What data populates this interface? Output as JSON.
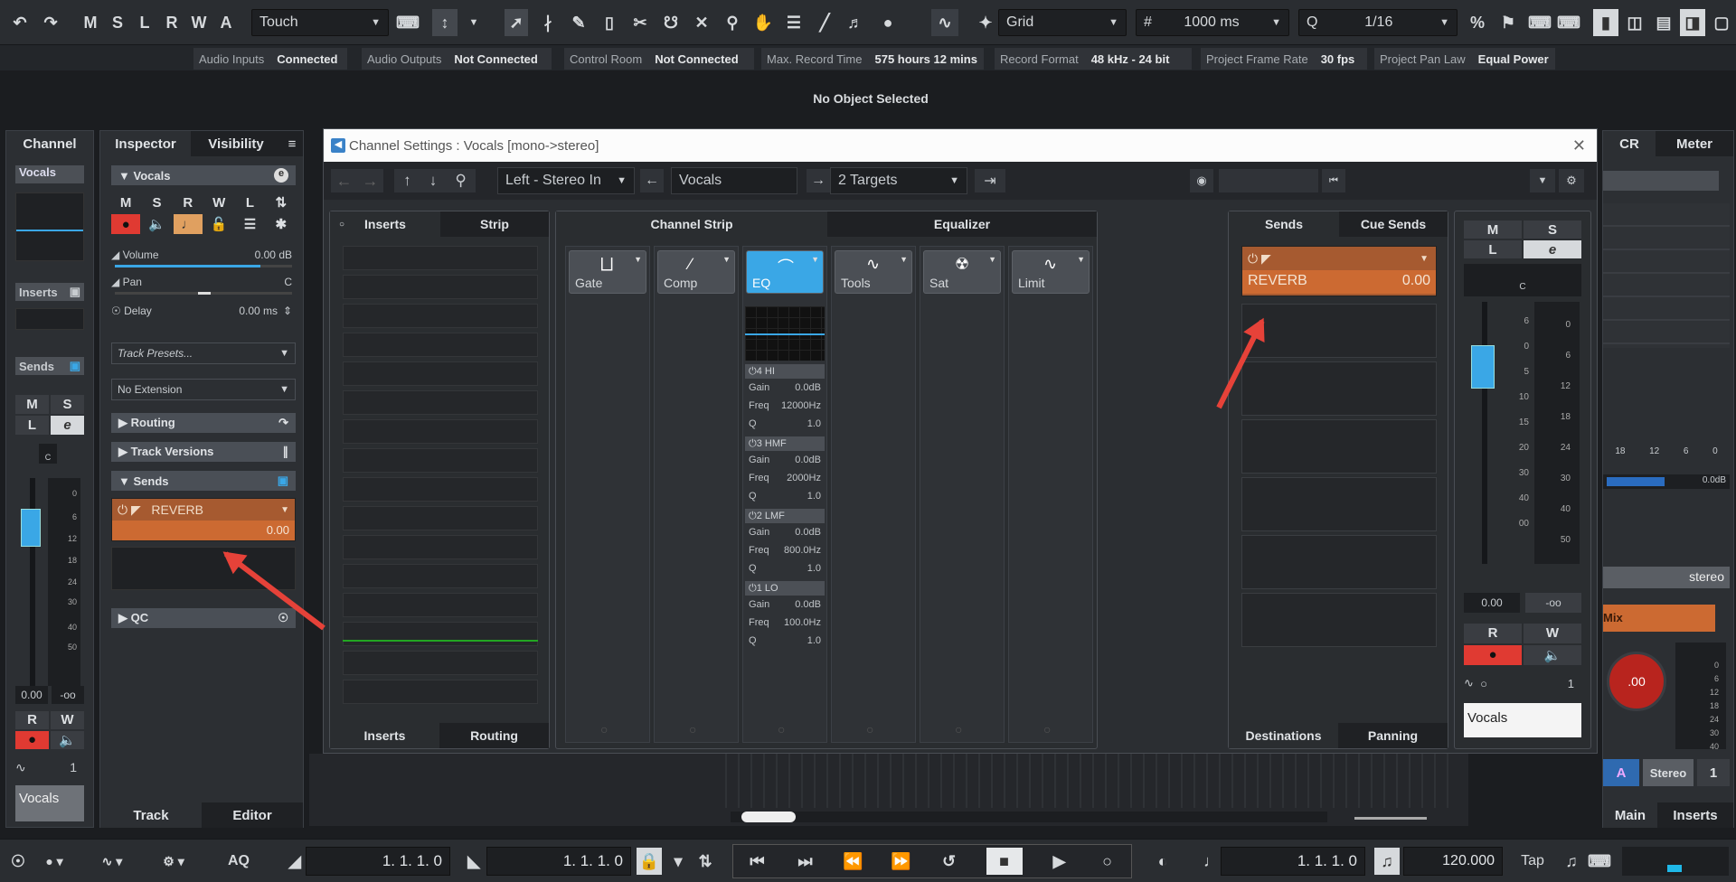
{
  "toolbar": {
    "mode_buttons": [
      "M",
      "S",
      "L",
      "R",
      "W",
      "A"
    ],
    "automation_mode": "Touch",
    "snap_type": "Grid",
    "grid_value": "1000 ms",
    "quantize_value": "1/16"
  },
  "status_bar": [
    {
      "label": "Audio Inputs",
      "value": "Connected"
    },
    {
      "label": "Audio Outputs",
      "value": "Not Connected"
    },
    {
      "label": "Control Room",
      "value": "Not Connected"
    },
    {
      "label": "Max. Record Time",
      "value": "575 hours 12 mins"
    },
    {
      "label": "Record Format",
      "value": "48 kHz - 24 bit"
    },
    {
      "label": "Project Frame Rate",
      "value": "30 fps"
    },
    {
      "label": "Project Pan Law",
      "value": "Equal Power"
    }
  ],
  "info_line": "No Object Selected",
  "channel_panel": {
    "tab": "Channel",
    "track_name": "Vocals",
    "inserts_label": "Inserts",
    "sends_label": "Sends",
    "m": "M",
    "s": "S",
    "l": "L",
    "e": "e",
    "r": "R",
    "w": "W",
    "fader_scale": [
      "0",
      "6",
      "12",
      "18",
      "24",
      "30",
      "40",
      "50"
    ],
    "value_left": "0.00",
    "value_right": "-oo",
    "channel_num": "1",
    "footer_name": "Vocals"
  },
  "inspector": {
    "tabs": [
      "Inspector",
      "Visibility"
    ],
    "track_name": "Vocals",
    "buttons_row1": [
      "M",
      "S",
      "R",
      "W",
      "L"
    ],
    "volume_label": "Volume",
    "volume_value": "0.00 dB",
    "volume_level": 0.82,
    "pan_label": "Pan",
    "pan_value": "C",
    "delay_label": "Delay",
    "delay_value": "0.00 ms",
    "track_presets": "Track Presets...",
    "extension": "No Extension",
    "sections": [
      "Routing",
      "Track Versions",
      "Sends"
    ],
    "send_name": "REVERB",
    "send_value": "0.00",
    "qc_label": "QC",
    "bottom_tabs": [
      "Track",
      "Editor"
    ]
  },
  "dialog": {
    "title": "Channel Settings : Vocals [mono->stereo]",
    "input": "Left - Stereo In",
    "channel_name": "Vocals",
    "targets": "2 Targets",
    "inserts_tab": "Inserts",
    "strip_tab": "Strip",
    "channel_strip_tab": "Channel Strip",
    "equalizer_tab": "Equalizer",
    "modules": [
      "Gate",
      "Comp",
      "EQ",
      "Tools",
      "Sat",
      "Limit"
    ],
    "eq_bands": [
      {
        "name": "4 HI",
        "gain": "0.0dB",
        "freq": "12000Hz",
        "q": "1.0"
      },
      {
        "name": "3 HMF",
        "gain": "0.0dB",
        "freq": "2000Hz",
        "q": "1.0"
      },
      {
        "name": "2 LMF",
        "gain": "0.0dB",
        "freq": "800.0Hz",
        "q": "1.0"
      },
      {
        "name": "1 LO",
        "gain": "0.0dB",
        "freq": "100.0Hz",
        "q": "1.0"
      }
    ],
    "eq_labels": {
      "gain": "Gain",
      "freq": "Freq",
      "q": "Q"
    },
    "sends_tab": "Sends",
    "cue_sends_tab": "Cue Sends",
    "send_name": "REVERB",
    "send_value": "0.00",
    "bottom_left_tabs": [
      "Inserts",
      "Routing"
    ],
    "bottom_right_tabs": [
      "Destinations",
      "Panning"
    ],
    "fader": {
      "m": "M",
      "s": "S",
      "l": "L",
      "e": "e",
      "pan": "C",
      "scale_left": [
        "6",
        "0",
        "5",
        "10",
        "15",
        "20",
        "30",
        "40",
        "00"
      ],
      "scale_right": [
        "0",
        "6",
        "12",
        "18",
        "24",
        "30",
        "40",
        "50"
      ],
      "value_left": "0.00",
      "value_right": "-oo",
      "r": "R",
      "w": "W",
      "num": "1",
      "name": "Vocals"
    }
  },
  "right_zone": {
    "tabs": [
      "CR",
      "Meter"
    ],
    "meter_scale": [
      "18",
      "12",
      "6",
      "0"
    ],
    "meter_value": "0.0dB",
    "output": "stereo",
    "mix_label": "Mix",
    "knob_value": ".00",
    "knob_scale": [
      "0",
      "6",
      "12",
      "18",
      "24",
      "30",
      "40"
    ],
    "buttons": [
      "A",
      "Stereo",
      "1"
    ],
    "bottom_tabs": [
      "Main",
      "Inserts"
    ]
  },
  "transport": {
    "aq": "AQ",
    "left_locator": "1. 1. 1.   0",
    "right_locator": "1. 1. 1.   0",
    "position": "1. 1. 1.   0",
    "tempo": "120.000",
    "tap": "Tap"
  },
  "colors": {
    "accent": "#3aa7e6",
    "send": "#cc6a32",
    "record": "#e03a32",
    "arrow": "#e64239"
  }
}
